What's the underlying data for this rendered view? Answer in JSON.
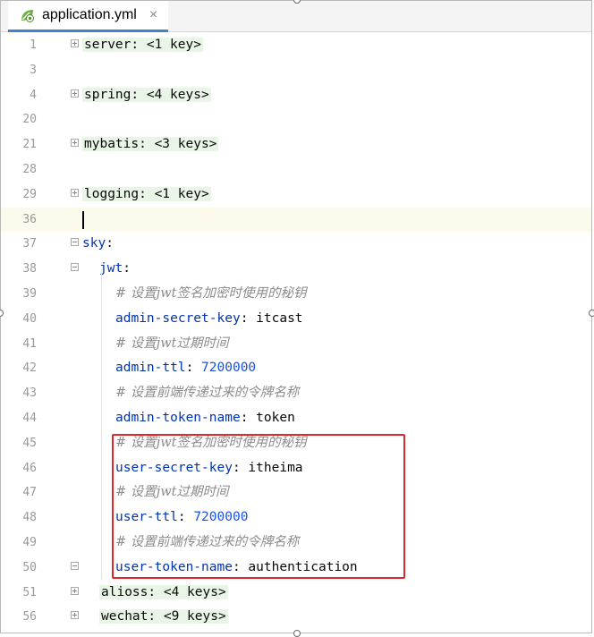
{
  "tab": {
    "title": "application.yml",
    "icon": "spring-leaf-icon",
    "close": "×"
  },
  "lines": [
    {
      "no": "1",
      "kind": "folded",
      "text": "server: <1 key>"
    },
    {
      "no": "3",
      "kind": "empty"
    },
    {
      "no": "4",
      "kind": "folded",
      "text": "spring: <4 keys>"
    },
    {
      "no": "20",
      "kind": "empty"
    },
    {
      "no": "21",
      "kind": "folded",
      "text": "mybatis: <3 keys>"
    },
    {
      "no": "28",
      "kind": "empty"
    },
    {
      "no": "29",
      "kind": "folded",
      "text": "logging: <1 key>"
    },
    {
      "no": "36",
      "kind": "current"
    },
    {
      "no": "37",
      "kind": "key",
      "key": "sky"
    },
    {
      "no": "38",
      "kind": "key",
      "key": "jwt"
    },
    {
      "no": "39",
      "kind": "comment",
      "text": "# 设置jwt签名加密时使用的秘钥"
    },
    {
      "no": "40",
      "kind": "pair",
      "key": "admin-secret-key",
      "value": "itcast"
    },
    {
      "no": "41",
      "kind": "comment",
      "text": "# 设置jwt过期时间"
    },
    {
      "no": "42",
      "kind": "pairnum",
      "key": "admin-ttl",
      "value": "7200000"
    },
    {
      "no": "43",
      "kind": "comment",
      "text": "# 设置前端传递过来的令牌名称"
    },
    {
      "no": "44",
      "kind": "pair",
      "key": "admin-token-name",
      "value": "token"
    },
    {
      "no": "45",
      "kind": "comment",
      "text": "# 设置jwt签名加密时使用的秘钥"
    },
    {
      "no": "46",
      "kind": "pair",
      "key": "user-secret-key",
      "value": "itheima"
    },
    {
      "no": "47",
      "kind": "comment",
      "text": "# 设置jwt过期时间"
    },
    {
      "no": "48",
      "kind": "pairnum",
      "key": "user-ttl",
      "value": "7200000"
    },
    {
      "no": "49",
      "kind": "comment",
      "text": "# 设置前端传递过来的令牌名称"
    },
    {
      "no": "50",
      "kind": "pair",
      "key": "user-token-name",
      "value": "authentication"
    },
    {
      "no": "51",
      "kind": "folded",
      "text": "alioss: <4 keys>"
    },
    {
      "no": "56",
      "kind": "folded",
      "text": "wechat: <9 keys>"
    }
  ],
  "colors": {
    "key": "#0033b3",
    "number": "#1750eb",
    "comment": "#8c8c8c",
    "highlight_box": "#e0262d",
    "current_line": "#fcfaed",
    "folded_bg": "#e9f5e6"
  }
}
